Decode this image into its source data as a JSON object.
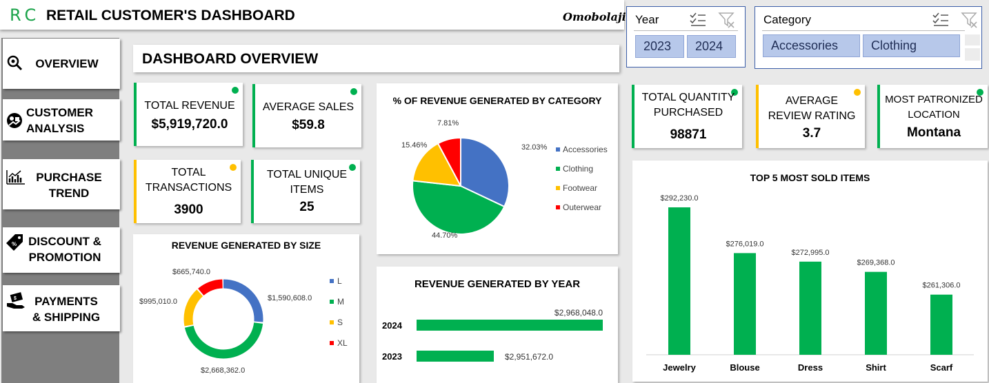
{
  "header": {
    "logo": "RC",
    "title": "RETAIL CUSTOMER'S DASHBOARD",
    "author": "Omobolaji"
  },
  "slicers": {
    "year": {
      "title": "Year",
      "items": [
        "2023",
        "2024"
      ]
    },
    "category": {
      "title": "Category",
      "items": [
        "Accessories",
        "Clothing"
      ]
    }
  },
  "nav": {
    "overview": "OVERVIEW",
    "customer": "CUSTOMER\nANALYSIS",
    "purchase": "PURCHASE\nTREND",
    "discount": "DISCOUNT &\nPROMOTION",
    "payments": "PAYMENTS\n& SHIPPING"
  },
  "overview_title": "DASHBOARD OVERVIEW",
  "kpis": {
    "total_revenue": {
      "label": "TOTAL REVENUE",
      "value": "$5,919,720.0"
    },
    "average_sales": {
      "label": "AVERAGE SALES",
      "value": "$59.8"
    },
    "total_transactions": {
      "label": "TOTAL\nTRANSACTIONS",
      "value": "3900"
    },
    "unique_items": {
      "label": "TOTAL UNIQUE\nITEMS",
      "value": "25"
    },
    "total_quantity": {
      "label": "TOTAL QUANTITY\nPURCHASED",
      "value": "98871"
    },
    "avg_rating": {
      "label": "AVERAGE\nREVIEW RATING",
      "value": "3.7"
    },
    "location": {
      "label": "MOST PATRONIZED\nLOCATION",
      "value": "Montana"
    }
  },
  "colors": {
    "green": "#00b050",
    "yellow": "#ffc000",
    "blue": "#4472c4",
    "red": "#ff0000"
  },
  "chart_data": [
    {
      "type": "pie",
      "title": "% OF REVENUE GENERATED BY CATEGORY",
      "categories": [
        "Accessories",
        "Clothing",
        "Footwear",
        "Outerwear"
      ],
      "values": [
        32.03,
        44.7,
        15.46,
        7.81
      ],
      "labels": [
        "32.03%",
        "44.70%",
        "15.46%",
        "7.81%"
      ],
      "colors": [
        "#4472c4",
        "#00b050",
        "#ffc000",
        "#ff0000"
      ],
      "legend": "right"
    },
    {
      "type": "pie",
      "title": "REVENUE GENERATED BY SIZE",
      "categories": [
        "L",
        "M",
        "S",
        "XL"
      ],
      "values": [
        1590608.0,
        2668362.0,
        995010.0,
        665740.0
      ],
      "labels": [
        "$1,590,608.0",
        "$2,668,362.0",
        "$995,010.0",
        "$665,740.0"
      ],
      "colors": [
        "#4472c4",
        "#00b050",
        "#ffc000",
        "#ff0000"
      ],
      "legend": "right"
    },
    {
      "type": "bar",
      "title": "REVENUE GENERATED BY YEAR",
      "categories": [
        "2024",
        "2023"
      ],
      "values": [
        2968048.0,
        2951672.0
      ],
      "labels": [
        "$2,968,048.0",
        "$2,951,672.0"
      ],
      "color": "#00b050"
    },
    {
      "type": "bar",
      "title": "TOP 5 MOST SOLD ITEMS",
      "categories": [
        "Jewelry",
        "Blouse",
        "Dress",
        "Shirt",
        "Scarf"
      ],
      "values": [
        292230.0,
        276019.0,
        272995.0,
        269368.0,
        261306.0
      ],
      "labels": [
        "$292,230.0",
        "$276,019.0",
        "$272,995.0",
        "$269,368.0",
        "$261,306.0"
      ],
      "color": "#00b050"
    }
  ]
}
